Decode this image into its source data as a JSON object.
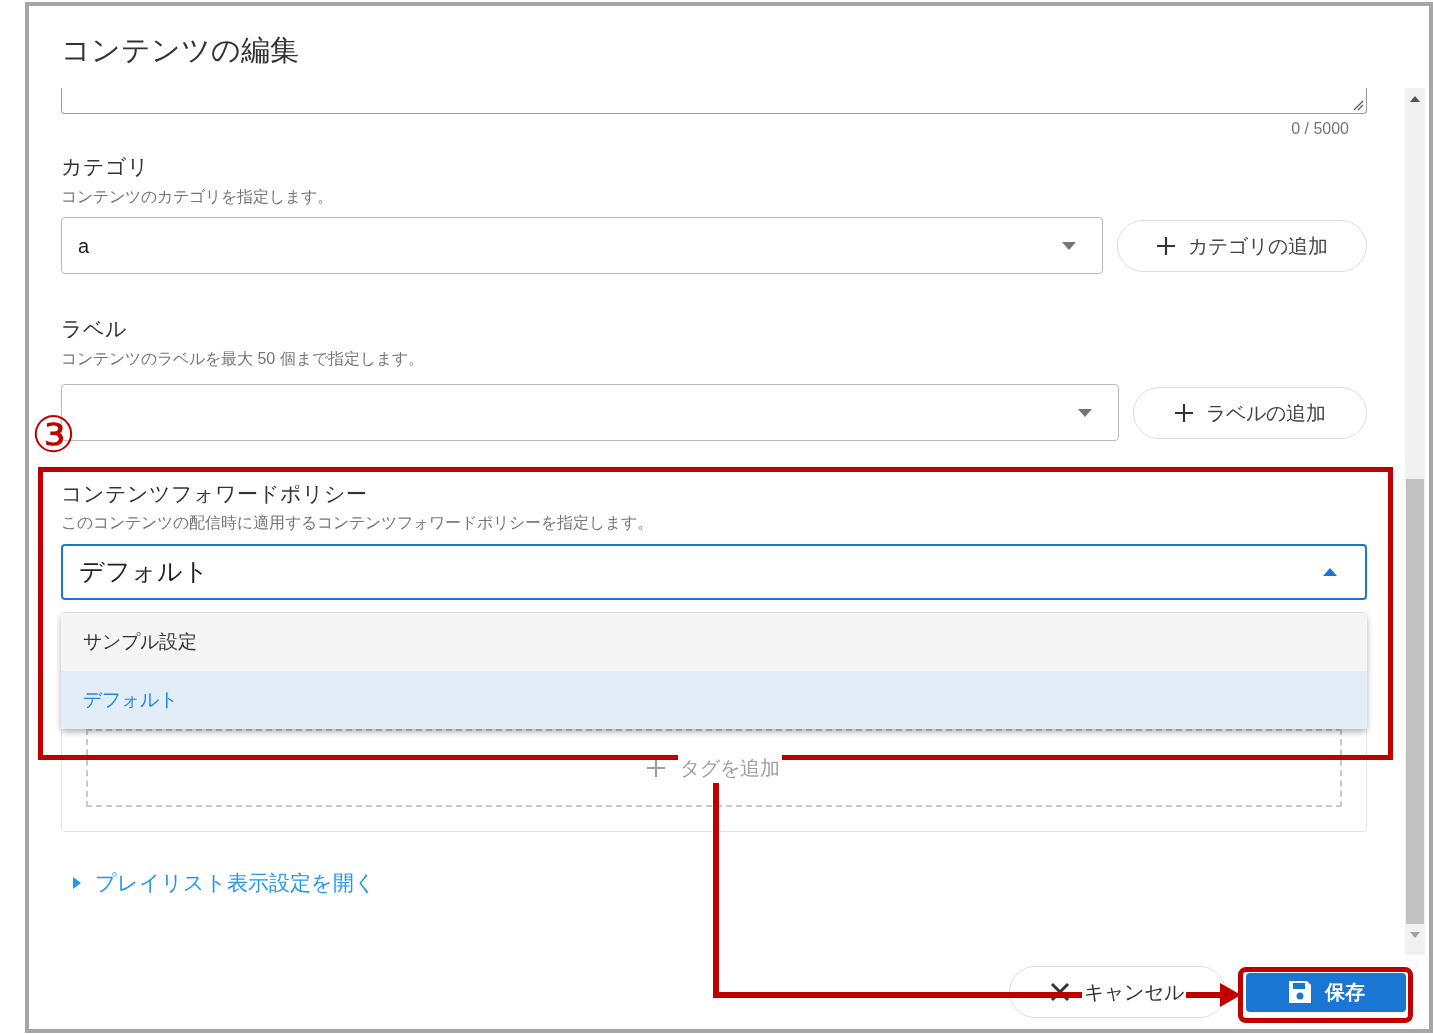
{
  "dialog_title": "コンテンツの編集",
  "description_counter": "0 / 5000",
  "category": {
    "label": "カテゴリ",
    "help": "コンテンツのカテゴリを指定します。",
    "value": "a",
    "add_button": "カテゴリの追加"
  },
  "label_field": {
    "label": "ラベル",
    "help": "コンテンツのラベルを最大 50 個まで指定します。",
    "add_button": "ラベルの追加"
  },
  "forward_policy": {
    "label": "コンテンツフォワードポリシー",
    "help": "このコンテンツの配信時に適用するコンテンツフォワードポリシーを指定します。",
    "value": "デフォルト",
    "expanded": true,
    "options": [
      {
        "label": "サンプル設定",
        "selected": false
      },
      {
        "label": "デフォルト",
        "selected": true
      }
    ]
  },
  "tags": {
    "add_button": "タグを追加"
  },
  "playlist_toggle": "プレイリスト表示設定を開く",
  "buttons": [
    {
      "kind": "cancel",
      "label": "キャンセル"
    },
    {
      "kind": "save",
      "label": "保存"
    }
  ],
  "annotation": {
    "step": "③"
  }
}
